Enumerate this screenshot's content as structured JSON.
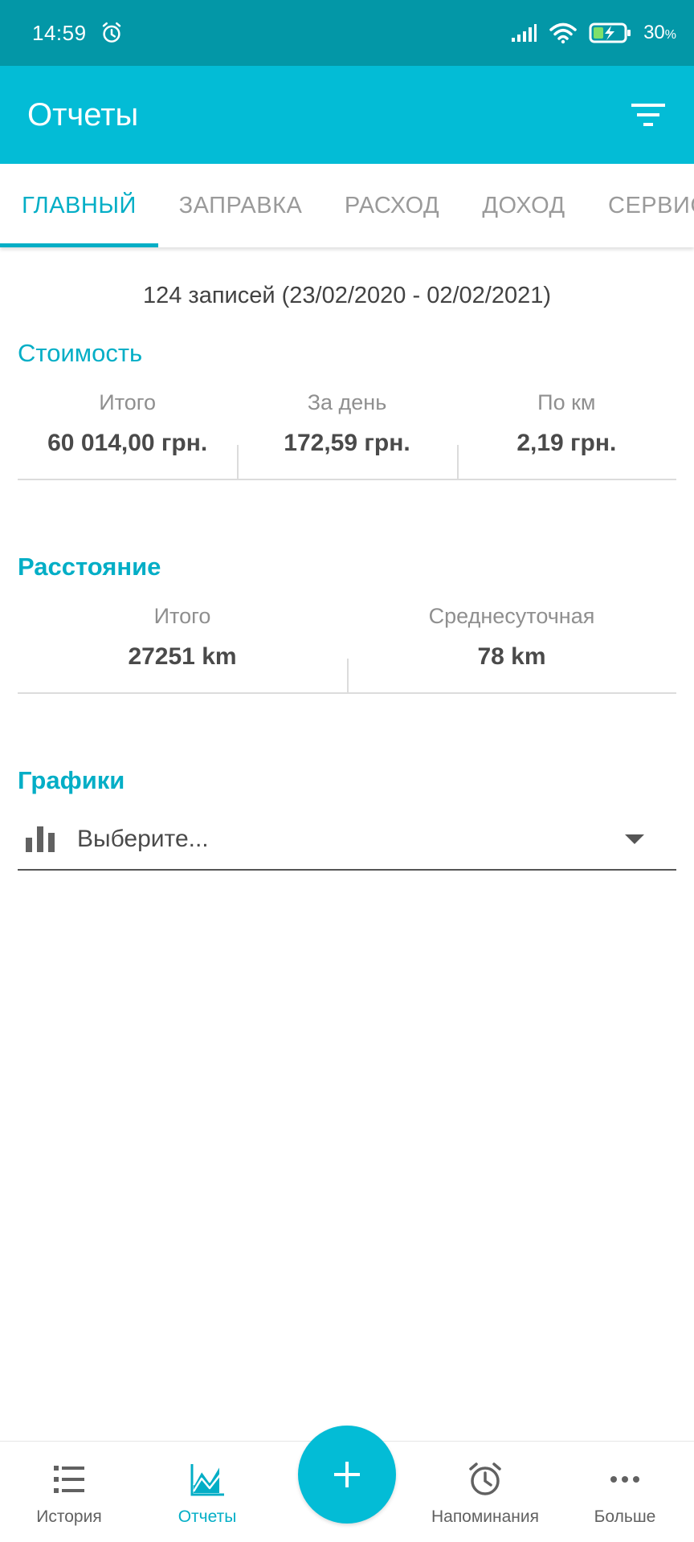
{
  "status_bar": {
    "time": "14:59",
    "battery_percent": "30",
    "battery_unit": "%"
  },
  "app_bar": {
    "title": "Отчеты"
  },
  "tabs": [
    {
      "label": "ГЛАВНЫЙ",
      "active": true
    },
    {
      "label": "ЗАПРАВКА",
      "active": false
    },
    {
      "label": "РАСХОД",
      "active": false
    },
    {
      "label": "ДОХОД",
      "active": false
    },
    {
      "label": "СЕРВИС",
      "active": false
    }
  ],
  "summary": {
    "records": "124 записей (23/02/2020 - 02/02/2021)"
  },
  "cost": {
    "title": "Стоимость",
    "stats": [
      {
        "label": "Итого",
        "value": "60 014,00 грн."
      },
      {
        "label": "За день",
        "value": "172,59 грн."
      },
      {
        "label": "По км",
        "value": "2,19 грн."
      }
    ]
  },
  "distance": {
    "title": "Расстояние",
    "stats": [
      {
        "label": "Итого",
        "value": "27251 km"
      },
      {
        "label": "Среднесуточная",
        "value": "78 km"
      }
    ]
  },
  "charts": {
    "title": "Графики",
    "select_placeholder": "Выберите..."
  },
  "bottom_nav": {
    "items": [
      {
        "label": "История",
        "icon": "list-icon"
      },
      {
        "label": "Отчеты",
        "icon": "chart-line-icon",
        "active": true
      },
      {
        "label": "Напоминания",
        "icon": "alarm-clock-icon"
      },
      {
        "label": "Больше",
        "icon": "more-dots-icon"
      }
    ],
    "fab_icon": "plus-icon"
  },
  "colors": {
    "primary": "#03bcd6",
    "status_bar": "#0397a7",
    "accent_text": "#03aec6"
  }
}
